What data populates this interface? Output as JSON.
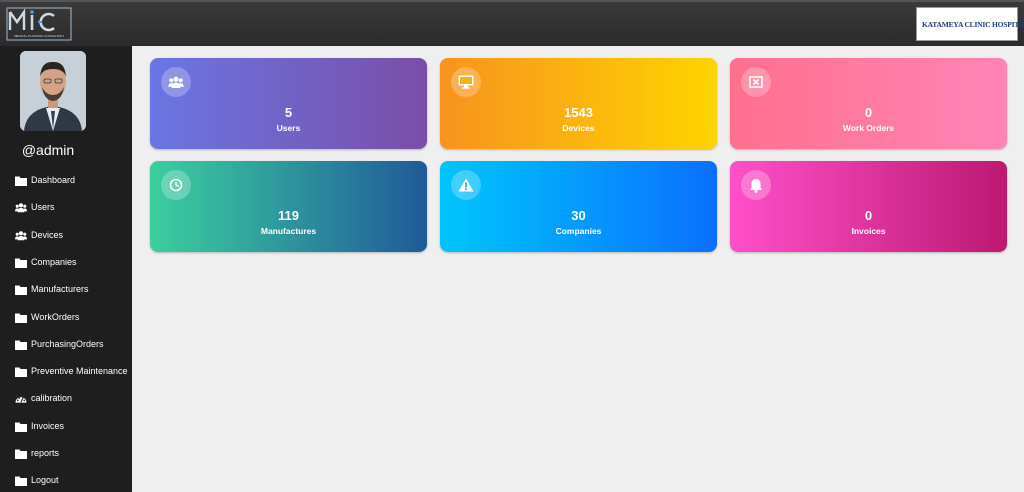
{
  "header": {
    "logo_text": "MIC",
    "logo_tagline": "MEDICAL PLANNING CONSULTANT",
    "hospital_name": "KATAMEYA CLINIC HOSPITAL"
  },
  "sidebar": {
    "username": "@admin",
    "items": [
      {
        "label": "Dashboard",
        "icon": "folder-icon"
      },
      {
        "label": "Users",
        "icon": "users-icon"
      },
      {
        "label": "Devices",
        "icon": "users-icon"
      },
      {
        "label": "Companies",
        "icon": "folder-icon"
      },
      {
        "label": "Manufacturers",
        "icon": "folder-icon"
      },
      {
        "label": "WorkOrders",
        "icon": "folder-icon"
      },
      {
        "label": "PurchasingOrders",
        "icon": "folder-icon"
      },
      {
        "label": "Preventive Maintenance",
        "icon": "folder-icon"
      },
      {
        "label": "calibration",
        "icon": "gauge-icon"
      },
      {
        "label": "Invoices",
        "icon": "folder-icon"
      },
      {
        "label": "reports",
        "icon": "folder-icon"
      },
      {
        "label": "Logout",
        "icon": "folder-icon"
      }
    ]
  },
  "cards": [
    {
      "value": "5",
      "label": "Users",
      "icon": "users-icon",
      "gradient": [
        "#6a76e3",
        "#7a4ea8"
      ]
    },
    {
      "value": "1543",
      "label": "Devices",
      "icon": "monitor-icon",
      "gradient": [
        "#f7931e",
        "#ffd400"
      ]
    },
    {
      "value": "0",
      "label": "Work Orders",
      "icon": "close-box-icon",
      "gradient": [
        "#ff6f8e",
        "#ff85b6"
      ]
    },
    {
      "value": "119",
      "label": "Manufactures",
      "icon": "clock-icon",
      "gradient": [
        "#3ccf9f",
        "#1f5a9a"
      ]
    },
    {
      "value": "30",
      "label": "Companies",
      "icon": "warning-icon",
      "gradient": [
        "#00c6fb",
        "#0a6fff"
      ]
    },
    {
      "value": "0",
      "label": "Invoices",
      "icon": "bell-icon",
      "gradient": [
        "#ff4fca",
        "#bc1972"
      ]
    }
  ]
}
